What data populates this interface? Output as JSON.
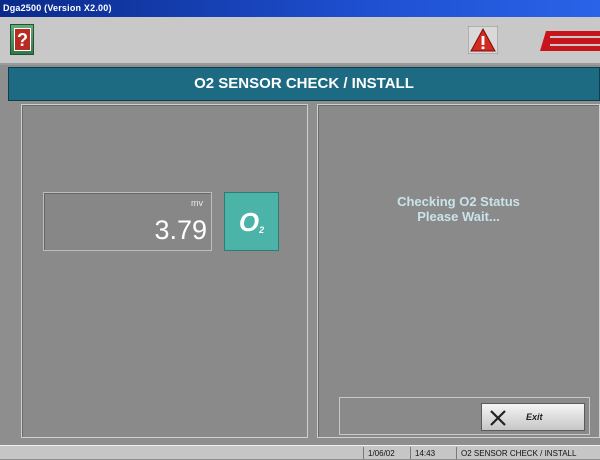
{
  "window": {
    "title": "Dga2500 (Version X2.00)"
  },
  "toolbar": {
    "help_icon": "help-book-icon",
    "help_glyph": "?",
    "warning_icon": "warning-triangle-icon",
    "logo_icon": "snap-on-logo"
  },
  "header": {
    "title": "O2 SENSOR CHECK / INSTALL"
  },
  "sensor": {
    "unit": "mv",
    "value": "3.79",
    "badge_letter": "O",
    "badge_subscript": "2"
  },
  "status": {
    "line1": "Checking O2 Status",
    "line2": "Please Wait..."
  },
  "exit": {
    "label": "Exit",
    "icon": "close-x-icon"
  },
  "statusbar": {
    "date": "1/06/02",
    "time": "14:43",
    "screen": "O2 SENSOR CHECK / INSTALL"
  },
  "colors": {
    "header_band": "#1d6a83",
    "o2_badge": "#4bb3a8",
    "status_text": "#c9e3ea",
    "panel": "#8a8a8a"
  }
}
